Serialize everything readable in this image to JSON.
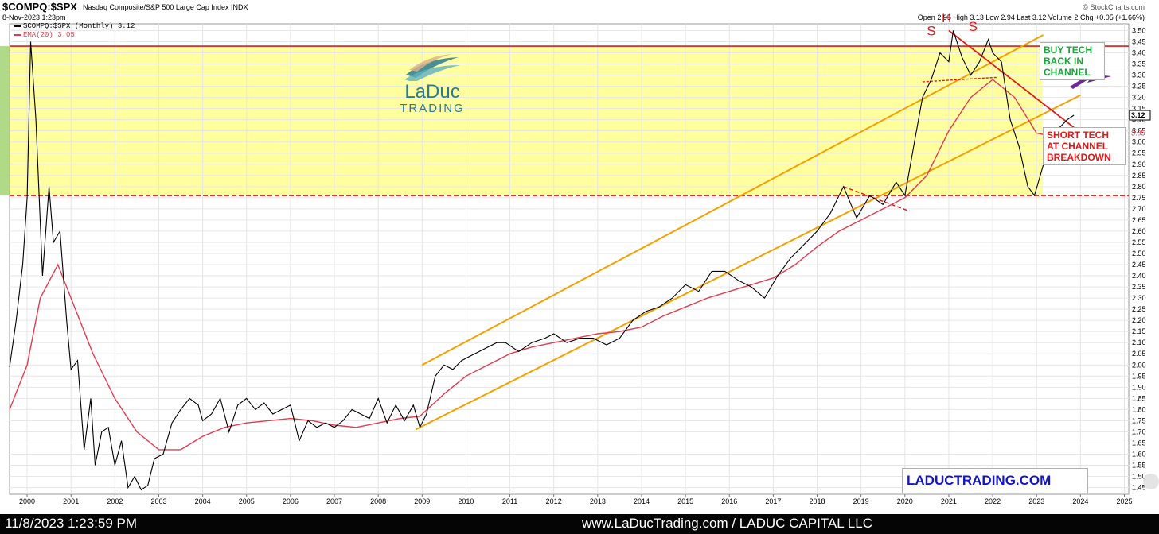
{
  "header": {
    "symbol": "$COMPQ:$SPX",
    "description": "Nasdaq Composite/S&P 500 Large Cap Index INDX",
    "date": "8-Nov-2023 1:23pm",
    "credit": "© StockCharts.com",
    "quote": "Open 2.95  High 3.13  Low 2.94  Last 3.12  Volume 2  Chg +0.05 (+1.66%)"
  },
  "legend": [
    {
      "label": "$COMPQ:$SPX (Monthly) 3.12",
      "color": "#000000"
    },
    {
      "label": "EMA(20) 3.05",
      "color": "#e03c50"
    }
  ],
  "logo": {
    "main": "LaDuc",
    "sub": "TRADING"
  },
  "annotations": {
    "buy": "BUY TECH BACK IN CHANNEL",
    "short": "SHORT TECH AT CHANNEL BREAKDOWN",
    "site": "LADUCTRADING.COM",
    "hs_left": "S",
    "hs_head": "H",
    "hs_right": "S"
  },
  "price_tags": {
    "last": "3.12",
    "ema": "3.05"
  },
  "footer": {
    "timestamp": "11/8/2023 1:23:59 PM",
    "source": "www.LaDucTrading.com / LADUC CAPITAL LLC"
  },
  "colors": {
    "price": "#000000",
    "ema": "#e03c50",
    "channel": "#f5a000",
    "zone": "#ffff8c",
    "resistance": "#e01818"
  },
  "chart_data": {
    "type": "line",
    "xlim": [
      1999.6,
      2025.1
    ],
    "ylim": [
      1.42,
      3.53
    ],
    "x_ticks": [
      2000,
      2001,
      2002,
      2003,
      2004,
      2005,
      2006,
      2007,
      2008,
      2009,
      2010,
      2011,
      2012,
      2013,
      2014,
      2015,
      2016,
      2017,
      2018,
      2019,
      2020,
      2021,
      2022,
      2023,
      2024,
      2025
    ],
    "y_ticks": [
      "1.45",
      "1.50",
      "1.55",
      "1.60",
      "1.65",
      "1.70",
      "1.75",
      "1.80",
      "1.85",
      "1.90",
      "1.95",
      "2.00",
      "2.05",
      "2.10",
      "2.15",
      "2.20",
      "2.25",
      "2.30",
      "2.35",
      "2.40",
      "2.45",
      "2.50",
      "2.55",
      "2.60",
      "2.65",
      "2.70",
      "2.75",
      "2.80",
      "2.85",
      "2.90",
      "2.95",
      "3.00",
      "3.05",
      "3.10",
      "3.15",
      "3.20",
      "3.25",
      "3.30",
      "3.35",
      "3.40",
      "3.45",
      "3.50"
    ],
    "grid": true,
    "series": [
      {
        "name": "$COMPQ:$SPX (Monthly)",
        "x": [
          1999.6,
          1999.75,
          1999.9,
          2000.0,
          2000.08,
          2000.2,
          2000.35,
          2000.5,
          2000.6,
          2000.75,
          2000.9,
          2001.0,
          2001.15,
          2001.3,
          2001.45,
          2001.55,
          2001.7,
          2001.85,
          2002.0,
          2002.15,
          2002.3,
          2002.45,
          2002.6,
          2002.75,
          2002.9,
          2003.1,
          2003.3,
          2003.5,
          2003.7,
          2003.9,
          2004.0,
          2004.2,
          2004.4,
          2004.6,
          2004.8,
          2005.0,
          2005.2,
          2005.4,
          2005.6,
          2005.8,
          2006.0,
          2006.2,
          2006.4,
          2006.6,
          2006.8,
          2007.0,
          2007.2,
          2007.4,
          2007.6,
          2007.8,
          2008.0,
          2008.2,
          2008.4,
          2008.6,
          2008.8,
          2008.95,
          2009.1,
          2009.3,
          2009.5,
          2009.7,
          2009.9,
          2010.1,
          2010.3,
          2010.5,
          2010.7,
          2010.9,
          2011.2,
          2011.5,
          2011.8,
          2012.0,
          2012.3,
          2012.6,
          2012.9,
          2013.2,
          2013.5,
          2013.8,
          2014.1,
          2014.4,
          2014.7,
          2015.0,
          2015.3,
          2015.6,
          2015.9,
          2016.2,
          2016.5,
          2016.8,
          2017.1,
          2017.4,
          2017.7,
          2018.0,
          2018.3,
          2018.6,
          2018.9,
          2019.2,
          2019.5,
          2019.8,
          2020.0,
          2020.2,
          2020.4,
          2020.6,
          2020.8,
          2021.0,
          2021.1,
          2021.3,
          2021.5,
          2021.7,
          2021.9,
          2022.0,
          2022.2,
          2022.4,
          2022.6,
          2022.8,
          2022.95,
          2023.1,
          2023.3,
          2023.5,
          2023.7,
          2023.85
        ],
        "y": [
          1.99,
          2.2,
          2.45,
          2.75,
          3.45,
          3.1,
          2.4,
          2.8,
          2.55,
          2.6,
          2.2,
          1.98,
          2.02,
          1.62,
          1.85,
          1.55,
          1.7,
          1.72,
          1.55,
          1.66,
          1.45,
          1.5,
          1.44,
          1.46,
          1.58,
          1.6,
          1.74,
          1.8,
          1.85,
          1.82,
          1.75,
          1.78,
          1.85,
          1.7,
          1.82,
          1.85,
          1.8,
          1.83,
          1.78,
          1.8,
          1.82,
          1.66,
          1.75,
          1.72,
          1.74,
          1.72,
          1.75,
          1.8,
          1.78,
          1.76,
          1.85,
          1.74,
          1.82,
          1.75,
          1.82,
          1.72,
          1.78,
          1.95,
          2.0,
          1.98,
          2.02,
          2.04,
          2.06,
          2.08,
          2.1,
          2.1,
          2.06,
          2.1,
          2.12,
          2.14,
          2.1,
          2.12,
          2.12,
          2.09,
          2.12,
          2.2,
          2.24,
          2.26,
          2.3,
          2.36,
          2.33,
          2.42,
          2.42,
          2.38,
          2.35,
          2.3,
          2.4,
          2.48,
          2.54,
          2.6,
          2.68,
          2.8,
          2.66,
          2.76,
          2.72,
          2.82,
          2.76,
          2.98,
          3.2,
          3.28,
          3.4,
          3.36,
          3.5,
          3.38,
          3.3,
          3.36,
          3.46,
          3.4,
          3.36,
          3.1,
          2.98,
          2.8,
          2.76,
          2.86,
          3.0,
          3.06,
          3.1,
          3.12
        ]
      },
      {
        "name": "EMA(20)",
        "x": [
          1999.6,
          2000.0,
          2000.3,
          2000.7,
          2001.0,
          2001.5,
          2002.0,
          2002.5,
          2003.0,
          2003.5,
          2004.0,
          2004.5,
          2005.0,
          2005.5,
          2006.0,
          2006.5,
          2007.0,
          2007.5,
          2008.0,
          2008.5,
          2008.95,
          2009.5,
          2010.0,
          2010.5,
          2011.0,
          2011.5,
          2012.0,
          2012.5,
          2013.0,
          2013.5,
          2014.0,
          2014.5,
          2015.0,
          2015.5,
          2016.0,
          2016.5,
          2017.0,
          2017.5,
          2018.0,
          2018.5,
          2019.0,
          2019.5,
          2020.0,
          2020.5,
          2021.0,
          2021.5,
          2022.0,
          2022.5,
          2023.0,
          2023.5,
          2023.85
        ],
        "y": [
          1.8,
          2.0,
          2.3,
          2.45,
          2.3,
          2.05,
          1.85,
          1.7,
          1.62,
          1.62,
          1.68,
          1.72,
          1.74,
          1.75,
          1.76,
          1.75,
          1.73,
          1.72,
          1.74,
          1.76,
          1.77,
          1.87,
          1.95,
          2.0,
          2.05,
          2.08,
          2.1,
          2.12,
          2.14,
          2.15,
          2.17,
          2.22,
          2.26,
          2.3,
          2.33,
          2.36,
          2.39,
          2.45,
          2.53,
          2.6,
          2.65,
          2.7,
          2.75,
          2.85,
          3.05,
          3.2,
          3.28,
          3.2,
          3.04,
          3.02,
          3.05
        ]
      }
    ],
    "channel": {
      "upper": {
        "x": [
          2009.0,
          2023.15
        ],
        "y": [
          2.0,
          3.48
        ]
      },
      "lower": {
        "x": [
          2008.85,
          2024.0
        ],
        "y": [
          1.71,
          3.21
        ]
      }
    },
    "resistance_band": {
      "y": [
        2.76,
        3.43
      ]
    }
  }
}
